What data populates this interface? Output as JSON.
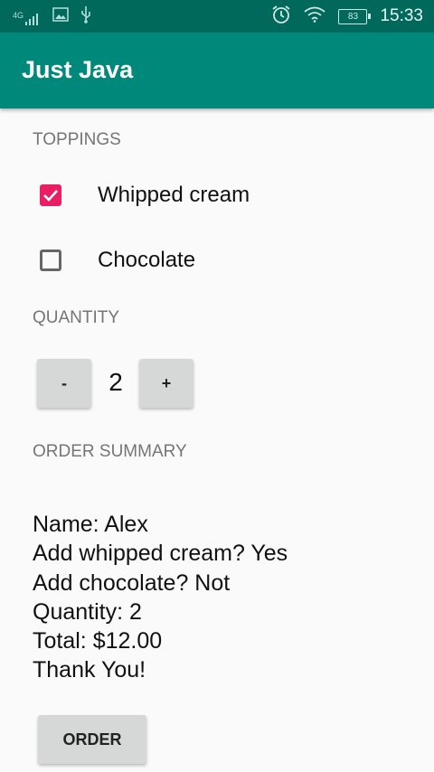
{
  "status_bar": {
    "network_label": "4G",
    "time": "15:33",
    "battery_level": "83"
  },
  "app_bar": {
    "title": "Just Java"
  },
  "toppings": {
    "section_label": "TOPPINGS",
    "items": [
      {
        "label": "Whipped cream",
        "checked": true
      },
      {
        "label": "Chocolate",
        "checked": false
      }
    ]
  },
  "quantity": {
    "section_label": "QUANTITY",
    "decrement_label": "-",
    "value": "2",
    "increment_label": "+"
  },
  "order_summary": {
    "section_label": "ORDER SUMMARY",
    "lines": [
      "Name: Alex",
      "Add whipped cream? Yes",
      "Add chocolate? Not",
      "Quantity: 2",
      "Total: $12.00",
      "Thank You!"
    ]
  },
  "order_button": {
    "label": "ORDER"
  },
  "colors": {
    "status_bar": "#00695c",
    "app_bar": "#00897b",
    "checkbox_checked": "#e91e63",
    "button": "#d6d7d7"
  }
}
